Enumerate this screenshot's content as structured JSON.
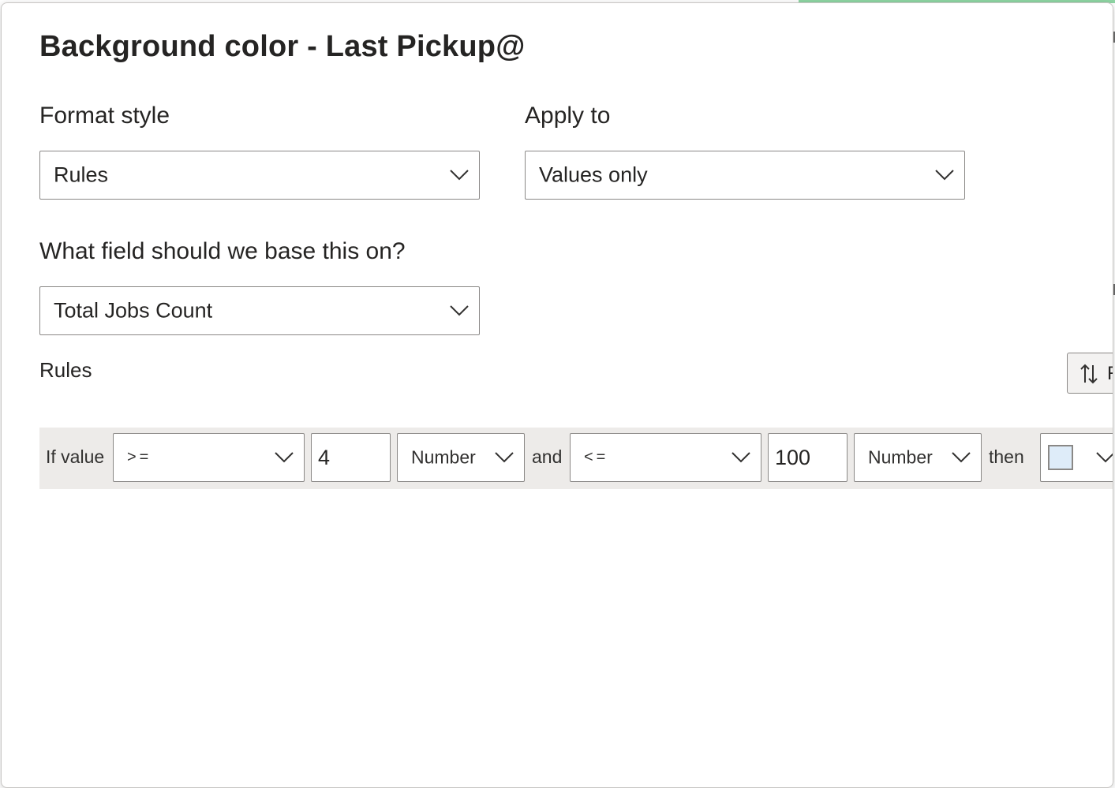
{
  "dialog": {
    "title": "Background color - Last Pickup@"
  },
  "format_style": {
    "label": "Format style",
    "value": "Rules"
  },
  "apply_to": {
    "label": "Apply to",
    "value": "Values only"
  },
  "base_field": {
    "label": "What field should we base this on?",
    "value": "Total Jobs Count"
  },
  "rules_section": {
    "label": "Rules",
    "reverse_button_label": "R"
  },
  "rule": {
    "if_label": "If value",
    "operator1": ">=",
    "value1": "4",
    "type1": "Number",
    "and_label": "and",
    "operator2": "<=",
    "value2": "100",
    "type2": "Number",
    "then_label": "then",
    "color": "#deecf9"
  }
}
